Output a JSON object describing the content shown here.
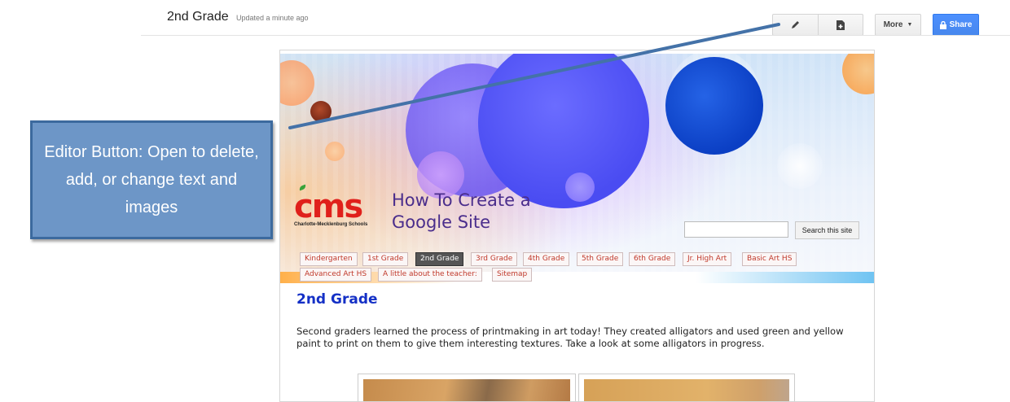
{
  "toolbar": {
    "page_name": "2nd Grade",
    "updated": "Updated a minute ago",
    "edit_icon": "pencil-icon",
    "new_page_icon": "new-page-icon",
    "more_label": "More",
    "share_label": "Share"
  },
  "site": {
    "logo_text": "cms",
    "logo_subtitle": "Charlotte-Mecklenburg Schools",
    "title_line1": "How To Create a",
    "title_line2": "Google Site",
    "search_button": "Search this site",
    "tabs": [
      "Kindergarten",
      "1st Grade",
      "2nd Grade",
      "3rd Grade",
      "4th Grade",
      "5th Grade",
      "6th Grade",
      "Jr. High Art",
      "Basic Art HS",
      "Advanced Art HS",
      "A little about the teacher:",
      "Sitemap"
    ],
    "active_tab": "2nd Grade",
    "content_title": "2nd Grade",
    "content_text": "Second graders learned the process of printmaking in art today! They created alligators and used green and yellow paint to print on them to give them interesting textures. Take a look at some alligators in progress."
  },
  "annotation": {
    "callout_text": "Editor Button: Open to delete, add, or change text and images",
    "color": "#6d96c7"
  },
  "colors": {
    "share_blue": "#4d90fe",
    "tab_text": "#c0392b",
    "title_purple": "#4a2d8c",
    "heading_blue": "#1430c6",
    "logo_red": "#e0201b"
  }
}
